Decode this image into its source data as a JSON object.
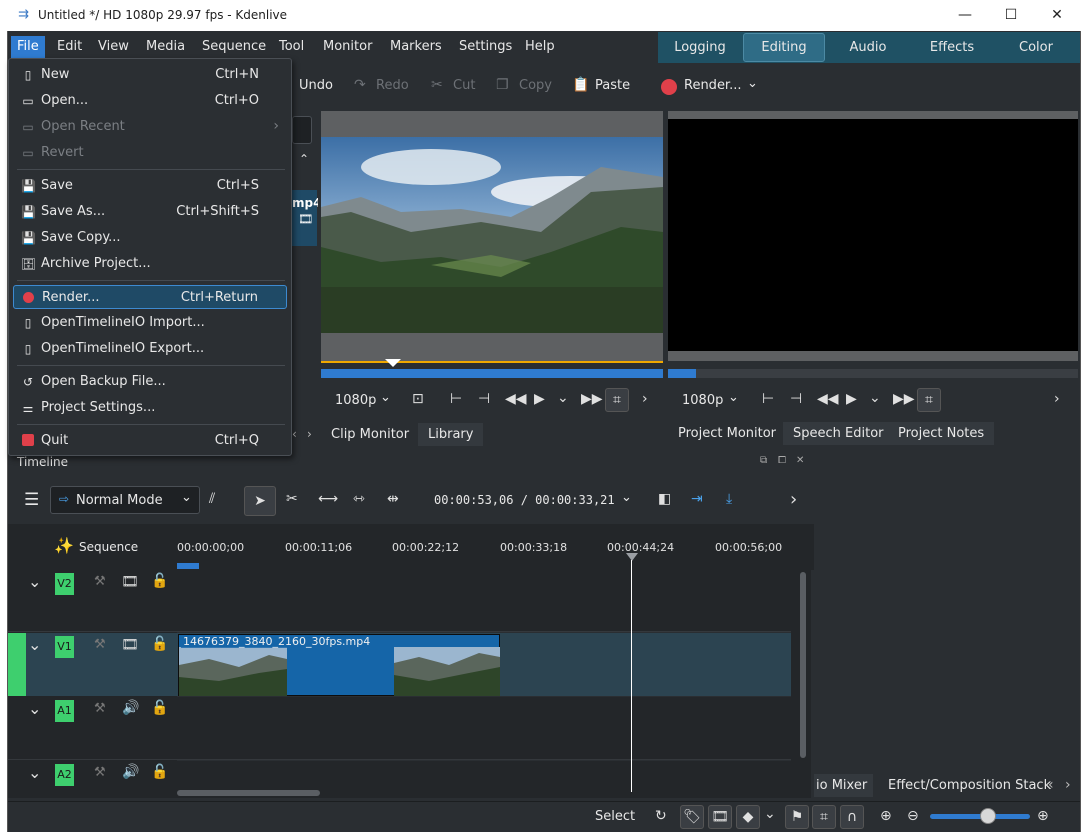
{
  "window": {
    "title": "Untitled */ HD 1080p 29.97 fps - Kdenlive",
    "min_icon": "minimize-icon",
    "max_icon": "maximize-icon",
    "close_icon": "close-icon"
  },
  "menubar": {
    "items": [
      "File",
      "Edit",
      "View",
      "Media",
      "Sequence",
      "Tool",
      "Monitor",
      "Markers",
      "Settings",
      "Help"
    ]
  },
  "workspaces": [
    "Logging",
    "Editing",
    "Audio",
    "Effects",
    "Color"
  ],
  "toolbar": {
    "undo": "Undo",
    "redo": "Redo",
    "cut": "Cut",
    "copy": "Copy",
    "paste": "Paste",
    "render": "Render..."
  },
  "file_menu": {
    "items": [
      {
        "label": "New",
        "shortcut": "Ctrl+N",
        "icon": "new-file-icon"
      },
      {
        "label": "Open...",
        "shortcut": "Ctrl+O",
        "icon": "open-folder-icon"
      },
      {
        "label": "Open Recent",
        "shortcut": "",
        "icon": "recent-icon"
      },
      {
        "label": "Revert",
        "shortcut": "",
        "icon": "revert-icon"
      },
      {
        "label": "Save",
        "shortcut": "Ctrl+S",
        "icon": "save-icon"
      },
      {
        "label": "Save As...",
        "shortcut": "Ctrl+Shift+S",
        "icon": "save-as-icon"
      },
      {
        "label": "Save Copy...",
        "shortcut": "",
        "icon": "save-copy-icon"
      },
      {
        "label": "Archive Project...",
        "shortcut": "",
        "icon": "archive-icon"
      },
      {
        "label": "Render...",
        "shortcut": "Ctrl+Return",
        "icon": "render-record-icon"
      },
      {
        "label": "OpenTimelineIO Import...",
        "shortcut": "",
        "icon": "import-icon"
      },
      {
        "label": "OpenTimelineIO Export...",
        "shortcut": "",
        "icon": "export-icon"
      },
      {
        "label": "Open Backup File...",
        "shortcut": "",
        "icon": "backup-icon"
      },
      {
        "label": "Project Settings...",
        "shortcut": "",
        "icon": "settings-sliders-icon"
      },
      {
        "label": "Quit",
        "shortcut": "Ctrl+Q",
        "icon": "quit-icon"
      }
    ]
  },
  "project_bin": {
    "clip_label_fragment": "mp4"
  },
  "clip_monitor": {
    "resolution": "1080p",
    "tabs": [
      "Clip Monitor",
      "Library"
    ]
  },
  "project_monitor": {
    "resolution": "1080p",
    "tabs": [
      "Project Monitor",
      "Speech Editor",
      "Project Notes"
    ]
  },
  "timeline": {
    "title": "Timeline",
    "mode": "Normal Mode",
    "timecode": "00:00:53,06 / 00:00:33,21",
    "sequence_label": "Sequence",
    "ruler": [
      "00:00:00;00",
      "00:00:11;06",
      "00:00:22;12",
      "00:00:33;18",
      "00:00:44;24",
      "00:00:56;00"
    ],
    "tracks": [
      {
        "name": "V2",
        "type": "video"
      },
      {
        "name": "V1",
        "type": "video"
      },
      {
        "name": "A1",
        "type": "audio"
      },
      {
        "name": "A2",
        "type": "audio"
      }
    ],
    "clip_name": "14676379_3840_2160_30fps.mp4"
  },
  "bottom_tabs": [
    "io Mixer",
    "Effect/Composition Stack"
  ],
  "statusbar": {
    "select_label": "Select"
  },
  "colors": {
    "accent": "#2f7bd0",
    "track_tag": "#3ecf6e",
    "clip_blue": "#1565a8",
    "render_red": "#e0404a",
    "ruler_marker": "#f0a800"
  }
}
